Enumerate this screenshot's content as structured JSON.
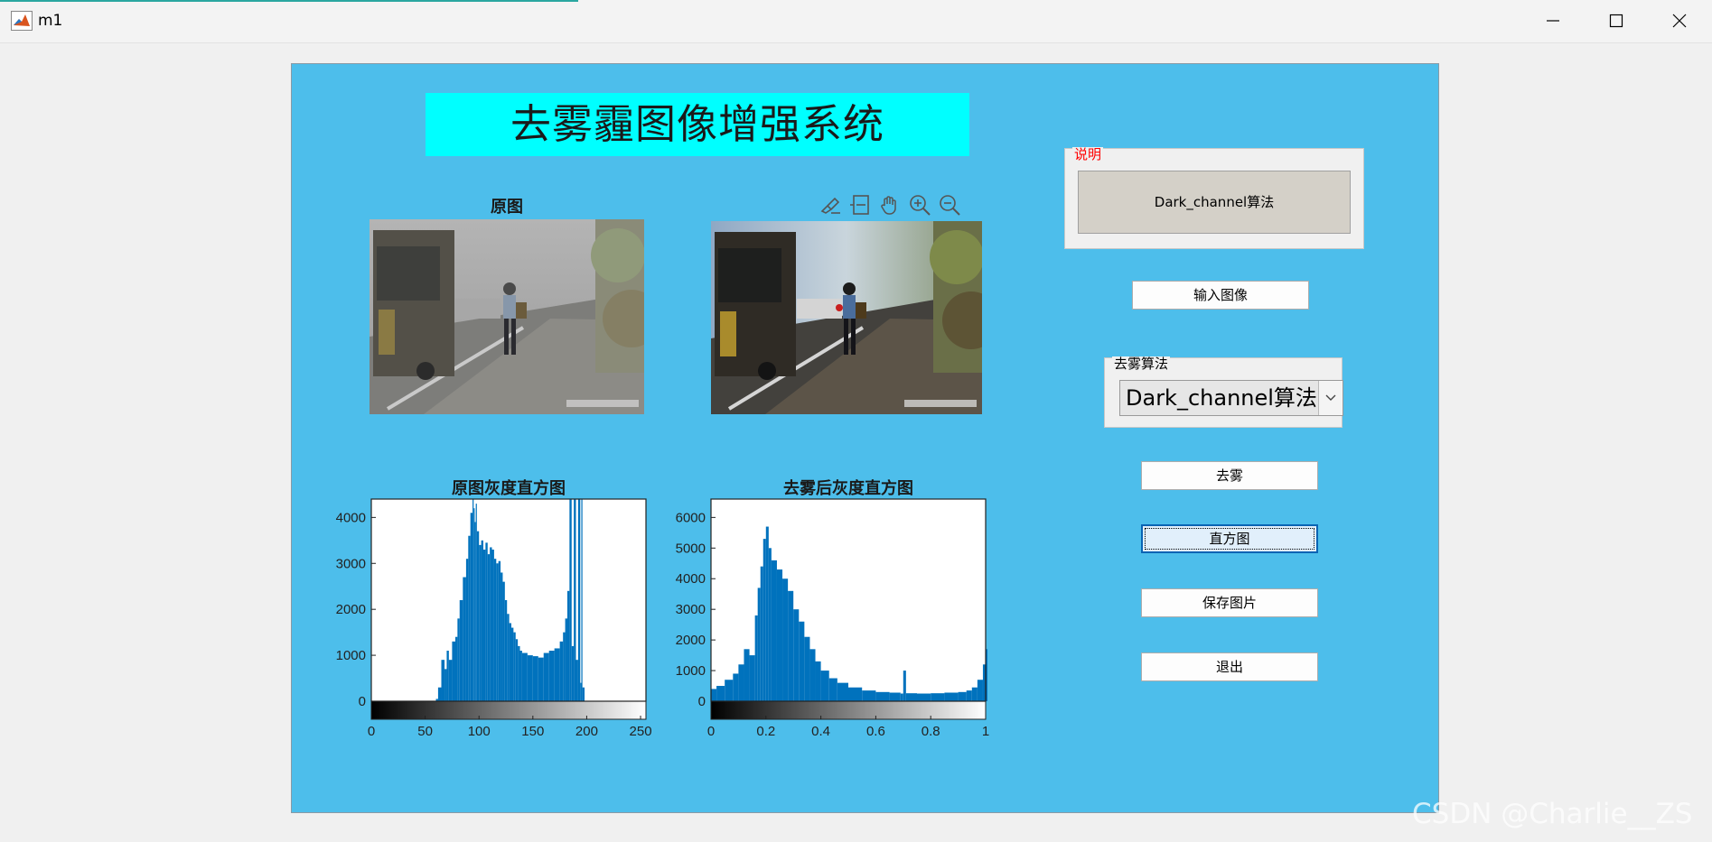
{
  "window": {
    "title": "m1"
  },
  "figure": {
    "title": "去雾霾图像增强系统",
    "original_image_title": "原图",
    "original_hist_title": "原图灰度直方图",
    "dehazed_hist_title": "去雾后灰度直方图",
    "toolbar_icons": [
      "brush-icon",
      "datatip-icon",
      "pan-icon",
      "zoom-in-icon",
      "zoom-out-icon",
      "home-icon"
    ]
  },
  "right_panel": {
    "description_legend": "说明",
    "description_text": "Dark_channel算法",
    "input_button": "输入图像",
    "algorithm_legend": "去雾算法",
    "algorithm_selected": "Dark_channel算法",
    "dehaze_button": "去雾",
    "histogram_button": "直方图",
    "save_button": "保存图片",
    "exit_button": "退出"
  },
  "colors": {
    "figure_background": "#4dbeeb",
    "title_background": "#00ffff",
    "histogram_bar": "#0072bd",
    "legend_red": "#ff0000"
  },
  "chart_data": [
    {
      "type": "bar",
      "title": "原图灰度直方图",
      "x_ticks": [
        "0",
        "50",
        "100",
        "150",
        "200",
        "250"
      ],
      "y_ticks": [
        "0",
        "1000",
        "2000",
        "3000",
        "4000"
      ],
      "xlim": [
        0,
        255
      ],
      "ylim": [
        0,
        4400
      ],
      "x": [
        0,
        10,
        20,
        30,
        40,
        50,
        55,
        60,
        62,
        65,
        68,
        70,
        72,
        75,
        78,
        80,
        82,
        85,
        88,
        90,
        92,
        94,
        95,
        96,
        97,
        98,
        100,
        102,
        104,
        106,
        108,
        110,
        112,
        114,
        116,
        118,
        120,
        122,
        124,
        126,
        128,
        130,
        132,
        134,
        136,
        138,
        140,
        145,
        150,
        155,
        160,
        165,
        170,
        175,
        178,
        180,
        182,
        184,
        186,
        188,
        190,
        192,
        194,
        195,
        196,
        198,
        200,
        202,
        205,
        210,
        220,
        230,
        240,
        250,
        255
      ],
      "y": [
        0,
        0,
        0,
        0,
        0,
        0,
        0,
        50,
        300,
        900,
        700,
        1100,
        900,
        1300,
        1400,
        1800,
        2200,
        2700,
        3100,
        3600,
        4100,
        4400,
        4200,
        3900,
        4300,
        3700,
        3400,
        3500,
        3300,
        3450,
        3200,
        3350,
        3300,
        3100,
        3000,
        3050,
        2800,
        2600,
        2200,
        1900,
        1700,
        1600,
        1500,
        1350,
        1200,
        1100,
        1050,
        1000,
        980,
        950,
        1050,
        1100,
        1150,
        1300,
        1500,
        1800,
        2400,
        4400,
        1200,
        4400,
        900,
        4400,
        400,
        4400,
        300,
        0,
        0,
        0,
        0,
        0,
        0,
        0,
        0,
        0,
        0
      ]
    },
    {
      "type": "bar",
      "title": "去雾后灰度直方图",
      "x_ticks": [
        "0",
        "0.2",
        "0.4",
        "0.6",
        "0.8",
        "1"
      ],
      "y_ticks": [
        "0",
        "1000",
        "2000",
        "3000",
        "4000",
        "5000",
        "6000"
      ],
      "xlim": [
        0,
        1
      ],
      "ylim": [
        0,
        6600
      ],
      "x": [
        0,
        0.02,
        0.05,
        0.08,
        0.1,
        0.12,
        0.14,
        0.16,
        0.17,
        0.18,
        0.19,
        0.2,
        0.21,
        0.22,
        0.24,
        0.26,
        0.28,
        0.3,
        0.32,
        0.34,
        0.36,
        0.38,
        0.4,
        0.43,
        0.46,
        0.5,
        0.55,
        0.6,
        0.65,
        0.69,
        0.7,
        0.71,
        0.75,
        0.8,
        0.85,
        0.9,
        0.93,
        0.95,
        0.97,
        0.99,
        1.0
      ],
      "y": [
        400,
        500,
        700,
        900,
        1200,
        1700,
        1500,
        2800,
        3700,
        4400,
        5300,
        5700,
        5000,
        4600,
        4300,
        4000,
        3600,
        3000,
        2600,
        2100,
        1700,
        1300,
        1000,
        750,
        600,
        450,
        350,
        300,
        280,
        250,
        1000,
        260,
        250,
        260,
        280,
        300,
        350,
        450,
        700,
        1200,
        1700
      ]
    }
  ]
}
